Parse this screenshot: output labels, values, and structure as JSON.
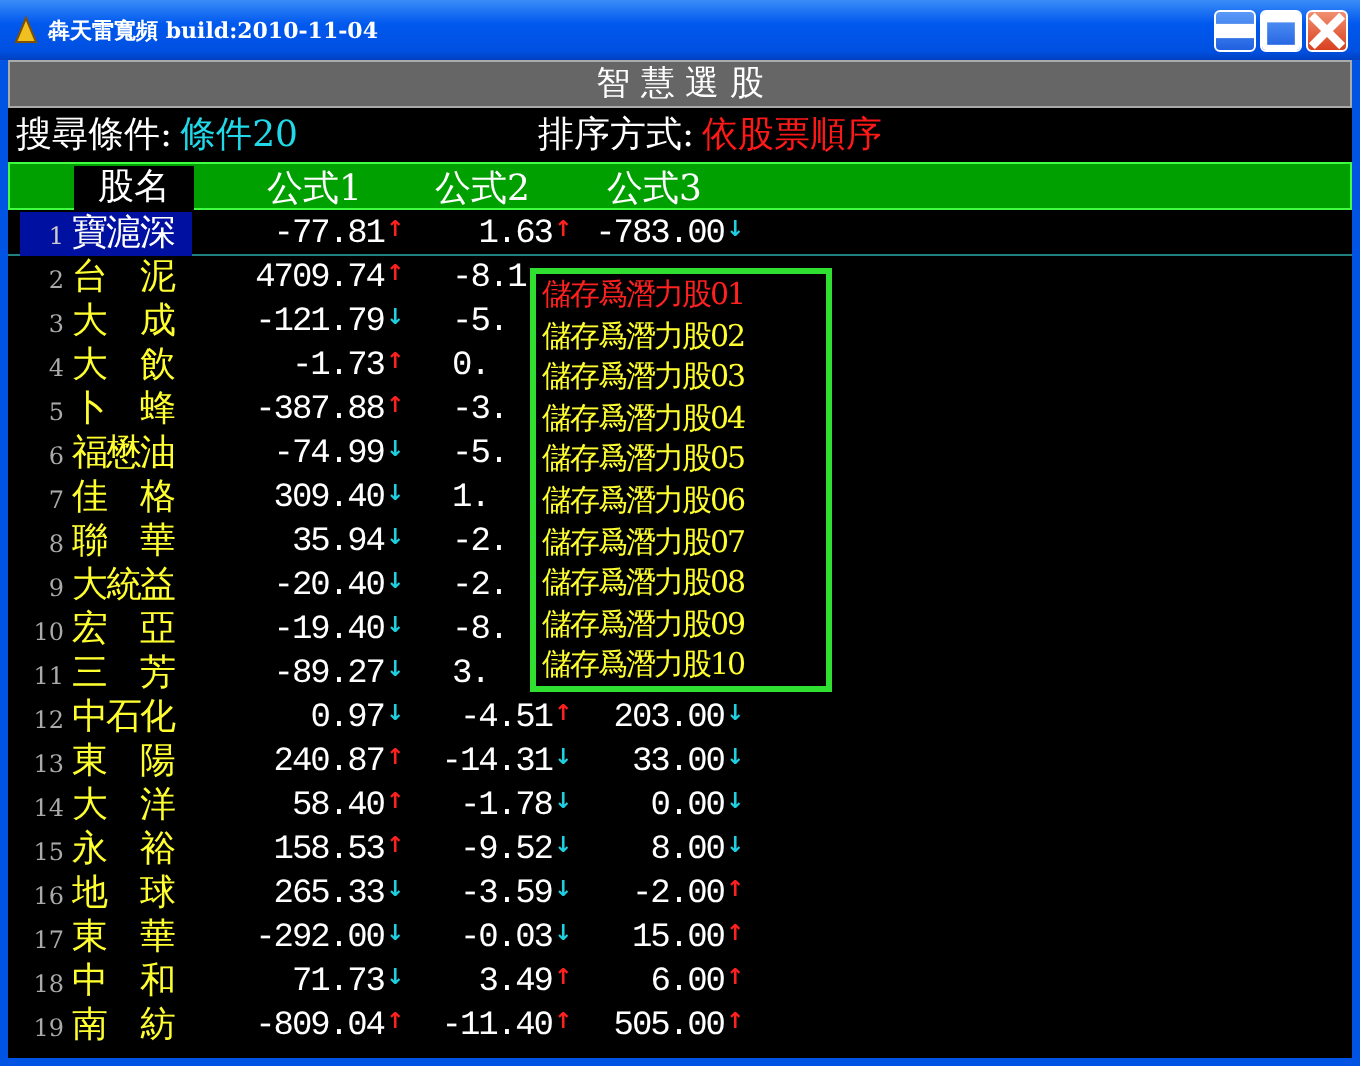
{
  "window": {
    "title": "犇天雷寬頻 build:2010-11-04"
  },
  "panel_title": "智 慧 選 股",
  "search": {
    "label": "搜尋條件:",
    "value": "條件20"
  },
  "sort": {
    "label": "排序方式:",
    "value": "依股票順序"
  },
  "table": {
    "columns": [
      "股名",
      "公式1",
      "公式2",
      "公式3"
    ],
    "rows": [
      {
        "no": "1",
        "cells": [
          {
            "value": "寶滬深"
          },
          {
            "value": "-77.81",
            "arrow": "↑",
            "color": "#ff2020"
          },
          {
            "value": "1.63",
            "arrow": "↑",
            "color": "#ff2020"
          },
          {
            "value": "-783.00",
            "arrow": "↓",
            "color": "#20d0e0"
          }
        ],
        "selected": true
      },
      {
        "no": "2",
        "cells": [
          {
            "value": "台　泥"
          },
          {
            "value": "4709.74",
            "arrow": "↑",
            "color": "#ff2020"
          },
          {
            "value": "-8.1",
            "cut": true
          }
        ],
        "selected": false
      },
      {
        "no": "3",
        "cells": [
          {
            "value": "大　成"
          },
          {
            "value": "-121.79",
            "arrow": "↓",
            "color": "#20d0e0"
          },
          {
            "value": "-5.",
            "cut": true
          }
        ],
        "selected": false
      },
      {
        "no": "4",
        "cells": [
          {
            "value": "大　飲"
          },
          {
            "value": "-1.73",
            "arrow": "↑",
            "color": "#ff2020"
          },
          {
            "value": "0.",
            "cut": true
          }
        ],
        "selected": false
      },
      {
        "no": "5",
        "cells": [
          {
            "value": "卜　蜂"
          },
          {
            "value": "-387.88",
            "arrow": "↑",
            "color": "#ff2020"
          },
          {
            "value": "-3.",
            "cut": true
          }
        ],
        "selected": false
      },
      {
        "no": "6",
        "cells": [
          {
            "value": "福懋油"
          },
          {
            "value": "-74.99",
            "arrow": "↓",
            "color": "#20d0e0"
          },
          {
            "value": "-5.",
            "cut": true
          }
        ],
        "selected": false
      },
      {
        "no": "7",
        "cells": [
          {
            "value": "佳　格"
          },
          {
            "value": "309.40",
            "arrow": "↓",
            "color": "#20d0e0"
          },
          {
            "value": "1.",
            "cut": true
          }
        ],
        "selected": false
      },
      {
        "no": "8",
        "cells": [
          {
            "value": "聯　華"
          },
          {
            "value": "35.94",
            "arrow": "↓",
            "color": "#20d0e0"
          },
          {
            "value": "-2.",
            "cut": true
          }
        ],
        "selected": false
      },
      {
        "no": "9",
        "cells": [
          {
            "value": "大統益"
          },
          {
            "value": "-20.40",
            "arrow": "↓",
            "color": "#20d0e0"
          },
          {
            "value": "-2.",
            "cut": true
          }
        ],
        "selected": false
      },
      {
        "no": "10",
        "cells": [
          {
            "value": "宏　亞"
          },
          {
            "value": "-19.40",
            "arrow": "↓",
            "color": "#20d0e0"
          },
          {
            "value": "-8.",
            "cut": true
          }
        ],
        "selected": false
      },
      {
        "no": "11",
        "cells": [
          {
            "value": "三　芳"
          },
          {
            "value": "-89.27",
            "arrow": "↓",
            "color": "#20d0e0"
          },
          {
            "value": "3.",
            "cut": true
          }
        ],
        "selected": false
      },
      {
        "no": "12",
        "cells": [
          {
            "value": "中石化"
          },
          {
            "value": "0.97",
            "arrow": "↓",
            "color": "#20d0e0"
          },
          {
            "value": "-4.51",
            "arrow": "↑",
            "color": "#ff2020"
          },
          {
            "value": "203.00",
            "arrow": "↓",
            "color": "#20d0e0"
          }
        ],
        "selected": false
      },
      {
        "no": "13",
        "cells": [
          {
            "value": "東　陽"
          },
          {
            "value": "240.87",
            "arrow": "↑",
            "color": "#ff2020"
          },
          {
            "value": "-14.31",
            "arrow": "↓",
            "color": "#20d0e0"
          },
          {
            "value": "33.00",
            "arrow": "↓",
            "color": "#20d0e0"
          }
        ],
        "selected": false
      },
      {
        "no": "14",
        "cells": [
          {
            "value": "大　洋"
          },
          {
            "value": "58.40",
            "arrow": "↑",
            "color": "#ff2020"
          },
          {
            "value": "-1.78",
            "arrow": "↓",
            "color": "#20d0e0"
          },
          {
            "value": "0.00",
            "arrow": "↓",
            "color": "#20d0e0"
          }
        ],
        "selected": false
      },
      {
        "no": "15",
        "cells": [
          {
            "value": "永　裕"
          },
          {
            "value": "158.53",
            "arrow": "↑",
            "color": "#ff2020"
          },
          {
            "value": "-9.52",
            "arrow": "↓",
            "color": "#20d0e0"
          },
          {
            "value": "8.00",
            "arrow": "↓",
            "color": "#20d0e0"
          }
        ],
        "selected": false
      },
      {
        "no": "16",
        "cells": [
          {
            "value": "地　球"
          },
          {
            "value": "265.33",
            "arrow": "↓",
            "color": "#20d0e0"
          },
          {
            "value": "-3.59",
            "arrow": "↓",
            "color": "#20d0e0"
          },
          {
            "value": "-2.00",
            "arrow": "↑",
            "color": "#ff2020"
          }
        ],
        "selected": false
      },
      {
        "no": "17",
        "cells": [
          {
            "value": "東　華"
          },
          {
            "value": "-292.00",
            "arrow": "↓",
            "color": "#20d0e0"
          },
          {
            "value": "-0.03",
            "arrow": "↓",
            "color": "#20d0e0"
          },
          {
            "value": "15.00",
            "arrow": "↑",
            "color": "#ff2020"
          }
        ],
        "selected": false
      },
      {
        "no": "18",
        "cells": [
          {
            "value": "中　和"
          },
          {
            "value": "71.73",
            "arrow": "↓",
            "color": "#20d0e0"
          },
          {
            "value": "3.49",
            "arrow": "↑",
            "color": "#ff2020"
          },
          {
            "value": "6.00",
            "arrow": "↑",
            "color": "#ff2020"
          }
        ],
        "selected": false
      },
      {
        "no": "19",
        "cells": [
          {
            "value": "南　紡"
          },
          {
            "value": "-809.04",
            "arrow": "↑",
            "color": "#ff2020"
          },
          {
            "value": "-11.40",
            "arrow": "↑",
            "color": "#ff2020"
          },
          {
            "value": "505.00",
            "arrow": "↑",
            "color": "#ff2020"
          }
        ],
        "selected": false
      }
    ]
  },
  "menu": {
    "items": [
      {
        "label": "儲存爲潛力股01",
        "selected": true
      },
      {
        "label": "儲存爲潛力股02",
        "selected": false
      },
      {
        "label": "儲存爲潛力股03",
        "selected": false
      },
      {
        "label": "儲存爲潛力股04",
        "selected": false
      },
      {
        "label": "儲存爲潛力股05",
        "selected": false
      },
      {
        "label": "儲存爲潛力股06",
        "selected": false
      },
      {
        "label": "儲存爲潛力股07",
        "selected": false
      },
      {
        "label": "儲存爲潛力股08",
        "selected": false
      },
      {
        "label": "儲存爲潛力股09",
        "selected": false
      },
      {
        "label": "儲存爲潛力股10",
        "selected": false
      }
    ]
  }
}
